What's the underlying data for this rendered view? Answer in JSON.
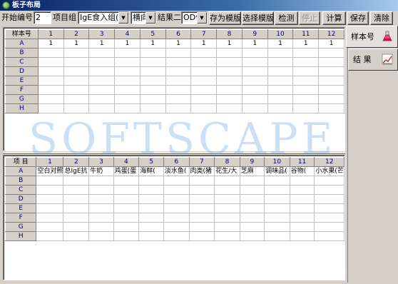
{
  "window": {
    "title": "板子布局"
  },
  "toolbar": {
    "start_label": "开始编号",
    "start_value": "2",
    "project_group_label": "项目组",
    "project_group_value": "IgE食入组(E",
    "direction_value": "横向",
    "result_label": "结果二",
    "result_value": "OD值",
    "buttons": {
      "save_template": "存为模版",
      "select_template": "选择模版",
      "detect": "检测",
      "stop": "停止",
      "calculate": "计算",
      "save": "保存",
      "clear": "清除"
    }
  },
  "top_grid": {
    "corner": "样本号",
    "columns": [
      "1",
      "2",
      "3",
      "4",
      "5",
      "6",
      "7",
      "8",
      "9",
      "10",
      "11",
      "12"
    ],
    "rows": [
      {
        "label": "A",
        "cells": [
          "1",
          "1",
          "1",
          "1",
          "1",
          "1",
          "1",
          "1",
          "1",
          "1",
          "1",
          "1"
        ]
      },
      {
        "label": "B",
        "cells": [
          "",
          "",
          "",
          "",
          "",
          "",
          "",
          "",
          "",
          "",
          "",
          ""
        ]
      },
      {
        "label": "C",
        "cells": [
          "",
          "",
          "",
          "",
          "",
          "",
          "",
          "",
          "",
          "",
          "",
          ""
        ]
      },
      {
        "label": "D",
        "cells": [
          "",
          "",
          "",
          "",
          "",
          "",
          "",
          "",
          "",
          "",
          "",
          ""
        ]
      },
      {
        "label": "E",
        "cells": [
          "",
          "",
          "",
          "",
          "",
          "",
          "",
          "",
          "",
          "",
          "",
          ""
        ]
      },
      {
        "label": "F",
        "cells": [
          "",
          "",
          "",
          "",
          "",
          "",
          "",
          "",
          "",
          "",
          "",
          ""
        ]
      },
      {
        "label": "G",
        "cells": [
          "",
          "",
          "",
          "",
          "",
          "",
          "",
          "",
          "",
          "",
          "",
          ""
        ]
      },
      {
        "label": "H",
        "cells": [
          "",
          "",
          "",
          "",
          "",
          "",
          "",
          "",
          "",
          "",
          "",
          ""
        ]
      }
    ]
  },
  "bottom_grid": {
    "corner": "项  目",
    "columns": [
      "1",
      "2",
      "3",
      "4",
      "5",
      "6",
      "7",
      "8",
      "9",
      "10",
      "11",
      "12"
    ],
    "rows": [
      {
        "label": "A",
        "cells": [
          "空白对照",
          "总IgE抗",
          "牛奶",
          "鸡蛋(蛋",
          "海鲜(",
          "淡水鱼(",
          "肉类(猪",
          "花生/大",
          "芝麻",
          "调味品(",
          "谷物(",
          "小水果(芒"
        ]
      },
      {
        "label": "B",
        "cells": [
          "",
          "",
          "",
          "",
          "",
          "",
          "",
          "",
          "",
          "",
          "",
          ""
        ]
      },
      {
        "label": "C",
        "cells": [
          "",
          "",
          "",
          "",
          "",
          "",
          "",
          "",
          "",
          "",
          "",
          ""
        ]
      },
      {
        "label": "D",
        "cells": [
          "",
          "",
          "",
          "",
          "",
          "",
          "",
          "",
          "",
          "",
          "",
          ""
        ]
      },
      {
        "label": "E",
        "cells": [
          "",
          "",
          "",
          "",
          "",
          "",
          "",
          "",
          "",
          "",
          "",
          ""
        ]
      },
      {
        "label": "F",
        "cells": [
          "",
          "",
          "",
          "",
          "",
          "",
          "",
          "",
          "",
          "",
          "",
          ""
        ]
      },
      {
        "label": "G",
        "cells": [
          "",
          "",
          "",
          "",
          "",
          "",
          "",
          "",
          "",
          "",
          "",
          ""
        ]
      },
      {
        "label": "H",
        "cells": [
          "",
          "",
          "",
          "",
          "",
          "",
          "",
          "",
          "",
          "",
          "",
          ""
        ]
      }
    ]
  },
  "side_tabs": [
    {
      "label": "样本号",
      "icon": "flask-icon",
      "active": true
    },
    {
      "label": "结  果",
      "icon": "chart-icon",
      "active": false
    }
  ],
  "watermark": "SOFTSCAPE"
}
